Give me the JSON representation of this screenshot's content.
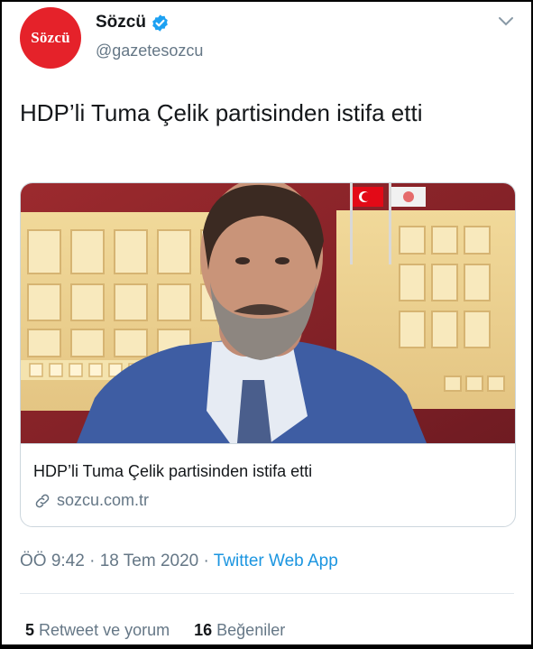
{
  "account": {
    "avatar_text": "Sözcü",
    "display_name": "Sözcü",
    "handle": "@gazetesozcu",
    "verified": true,
    "brand_color": "#e5222a"
  },
  "tweet": {
    "text": "HDP’li Tuma Çelik partisinden istifa etti",
    "timestamp_time": "ÖÖ 9:42",
    "separator": "·",
    "timestamp_date": "18 Tem 2020",
    "source_app": "Twitter Web App"
  },
  "card": {
    "title": "HDP’li Tuma Çelik partisinden istifa etti",
    "domain": "sozcu.com.tr",
    "link_icon": "link-icon"
  },
  "stats": {
    "retweets_count": "5",
    "retweets_label": "Retweet ve yorum",
    "likes_count": "16",
    "likes_label": "Beğeniler"
  },
  "colors": {
    "link_blue": "#1b95e0",
    "secondary_text": "#657786",
    "primary_text": "#14171a"
  }
}
